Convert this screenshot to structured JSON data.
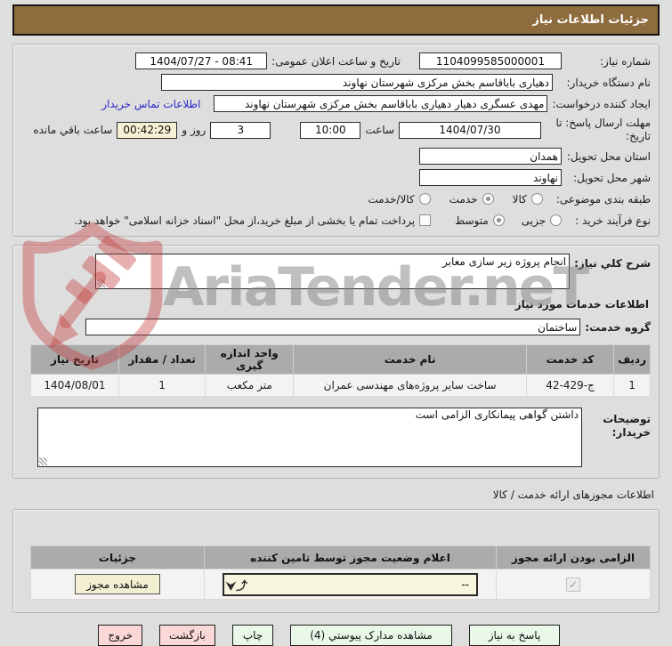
{
  "header": {
    "title": "جزئیات اطلاعات نیاز"
  },
  "info": {
    "need_number_label": "شماره نیاز:",
    "need_number": "1104099585000001",
    "announce_label": "تاریخ و ساعت اعلان عمومی:",
    "announce_value": "1404/07/27 - 08:41",
    "buyer_org_label": "نام دستگاه خریدار:",
    "buyer_org": "دهیاری باباقاسم بخش مرکزی شهرستان نهاوند",
    "creator_label": "ایجاد کننده درخواست:",
    "creator": "مهدی عسگری دهیار دهیاری باباقاسم بخش مرکزی شهرستان نهاوند",
    "contact_link": "اطلاعات تماس خریدار",
    "deadline_label": "مهلت ارسال پاسخ: تا تاریخ:",
    "deadline_date": "1404/07/30",
    "hour_label": "ساعت",
    "deadline_time": "10:00",
    "days_value": "3",
    "days_label": "روز و",
    "countdown": "00:42:29",
    "remaining_label": "ساعت باقي مانده",
    "province_label": "استان محل تحویل:",
    "province": "همدان",
    "city_label": "شهر محل تحویل:",
    "city": "نهاوند",
    "category_label": "طبقه بندی موضوعی:",
    "category_options": [
      {
        "label": "کالا",
        "selected": false
      },
      {
        "label": "خدمت",
        "selected": true
      },
      {
        "label": "کالا/خدمت",
        "selected": false
      }
    ],
    "process_label": "نوع فرآیند خرید :",
    "process_options": [
      {
        "label": "جزیی",
        "selected": false
      },
      {
        "label": "متوسط",
        "selected": true
      }
    ],
    "treasury_checkbox_label": "پرداخت تمام یا بخشی از مبلغ خرید،از محل \"اسناد خزانه اسلامی\" خواهد بود.",
    "treasury_checked": false
  },
  "need": {
    "desc_label": "شرح کلي نیاز:",
    "desc_value": "انجام پروژه زیر سازی معابر",
    "services_header": "اطلاعات خدمات مورد نیاز",
    "group_label": "گروه خدمت:",
    "group_value": "ساختمان",
    "services_table": {
      "headers": [
        "ردیف",
        "کد خدمت",
        "نام خدمت",
        "واحد اندازه گیری",
        "تعداد / مقدار",
        "تاریخ نیاز"
      ],
      "rows": [
        [
          "1",
          "ج-429-42",
          "ساخت سایر پروژه‌های مهندسی عمران",
          "متر مکعب",
          "1",
          "1404/08/01"
        ]
      ]
    },
    "notes_label": "توضیحات خریدار:",
    "notes_value": "داشتن گواهی پیمانکاری الزامی است"
  },
  "permits": {
    "section_label": "اطلاعات مجوزهای ارائه خدمت / کالا",
    "headers": [
      "الزامی بودن ارائه مجوز",
      "اعلام وضعیت مجوز توسط تامین کننده",
      "جزئیات"
    ],
    "row": {
      "required": true,
      "required_check": "✓",
      "status_value": "--",
      "details_button": "مشاهده مجوز"
    }
  },
  "actions": [
    {
      "label": "پاسخ به نیاز",
      "type": "green"
    },
    {
      "label": "مشاهده مدارک پیوستي (4)",
      "type": "green"
    },
    {
      "label": "چاپ",
      "type": "green"
    },
    {
      "label": "بازگشت",
      "type": "pink"
    },
    {
      "label": "خروج",
      "type": "pink"
    }
  ],
  "watermark": {
    "text": "AriaTender.neT"
  },
  "colors": {
    "titlebar": "#8e6c3e",
    "page_bg": "#dfdede",
    "table_header": "#ababab",
    "countdown_bg": "#f6f0d4",
    "green_button": "#e9f8e9",
    "pink_button": "#fbd8d8",
    "link": "#2929cc",
    "watermark_red": "#c34343"
  }
}
